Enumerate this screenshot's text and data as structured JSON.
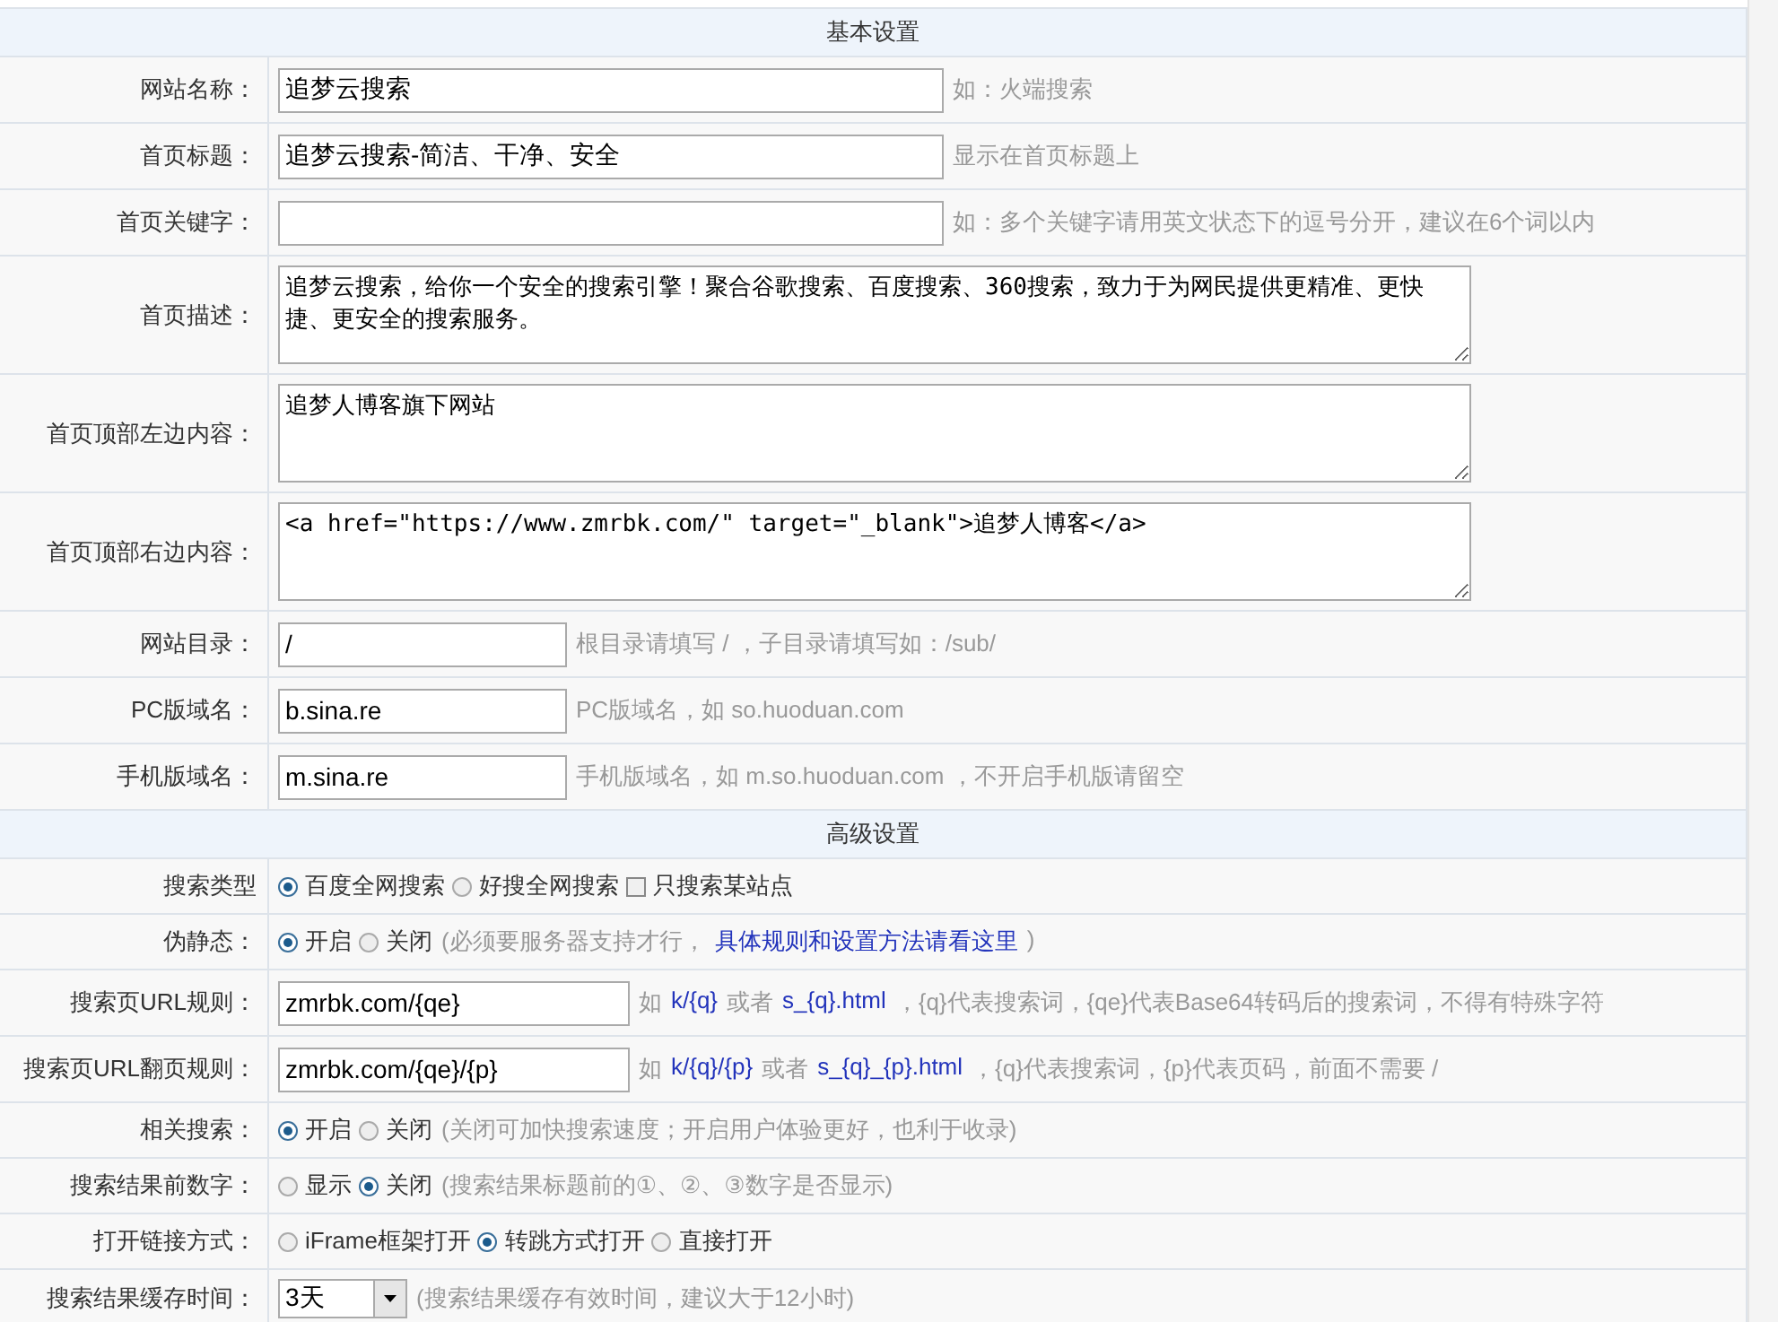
{
  "rows": [
    {
      "kind": "section",
      "title": "基本设置"
    },
    {
      "kind": "wide_input",
      "label": "网站名称：",
      "value": "追梦云搜索",
      "hint": [
        {
          "text": "如：火端搜索",
          "link": false
        }
      ]
    },
    {
      "kind": "wide_input",
      "label": "首页标题：",
      "value": "追梦云搜索-简洁、干净、安全",
      "hint": [
        {
          "text": "显示在首页标题上",
          "link": false
        }
      ]
    },
    {
      "kind": "wide_input",
      "label": "首页关键字：",
      "hint": [
        {
          "text": "如：多个关键字请用英文状态下的逗号分开，建议在6个词以内",
          "link": false
        }
      ]
    },
    {
      "kind": "textarea",
      "label": "首页描述：",
      "value": "追梦云搜索，给你一个安全的搜索引擎！聚合谷歌搜索、百度搜索、360搜索，致力于为网民提供更精准、更快捷、更安全的搜索服务。"
    },
    {
      "kind": "textarea",
      "label": "首页顶部左边内容：",
      "value": "追梦人博客旗下网站"
    },
    {
      "kind": "textarea",
      "label": "首页顶部右边内容：",
      "value": "<a href=\"https://www.zmrbk.com/\" target=\"_blank\">追梦人博客</a>"
    },
    {
      "kind": "short_input",
      "label": "网站目录：",
      "value": "/",
      "hint": [
        {
          "text": "根目录请填写 / ，子目录请填写如：/sub/",
          "link": false
        }
      ]
    },
    {
      "kind": "short_input",
      "label": "PC版域名：",
      "value": "b.sina.re",
      "hint": [
        {
          "text": "PC版域名，如 so.huoduan.com",
          "link": false
        }
      ]
    },
    {
      "kind": "short_input",
      "label": "手机版域名：",
      "value": "m.sina.re",
      "hint": [
        {
          "text": "手机版域名，如 m.so.huoduan.com ，不开启手机版请留空",
          "link": false
        }
      ]
    },
    {
      "kind": "section",
      "title": "高级设置"
    },
    {
      "kind": "options",
      "label": "搜索类型",
      "options": [
        {
          "kind": "radio",
          "label": "百度全网搜索",
          "selected": true
        },
        {
          "kind": "radio",
          "label": "好搜全网搜索",
          "selected": false
        },
        {
          "kind": "checkbox",
          "label": "只搜索某站点",
          "checked": false
        }
      ]
    },
    {
      "kind": "options",
      "label": "伪静态：",
      "options": [
        {
          "kind": "radio",
          "label": "开启",
          "selected": true
        },
        {
          "kind": "radio",
          "label": "关闭",
          "selected": false
        }
      ],
      "hint": [
        {
          "text": "(必须要服务器支持才行，",
          "link": false
        },
        {
          "text": "具体规则和设置方法请看这里",
          "link": true
        },
        {
          "text": ")",
          "link": false
        }
      ]
    },
    {
      "kind": "medium_input",
      "label": "搜索页URL规则：",
      "value": "zmrbk.com/{qe}",
      "hint": [
        {
          "text": "如",
          "link": false
        },
        {
          "text": "k/{q}",
          "link": true
        },
        {
          "text": "或者",
          "link": false
        },
        {
          "text": "s_{q}.html",
          "link": true
        },
        {
          "text": "，{q}代表搜索词，{qe}代表Base64转码后的搜索词，不得有特殊字符",
          "link": false
        }
      ]
    },
    {
      "kind": "medium_input",
      "label": "搜索页URL翻页规则：",
      "value": "zmrbk.com/{qe}/{p}",
      "hint": [
        {
          "text": "如",
          "link": false
        },
        {
          "text": "k/{q}/{p}",
          "link": true
        },
        {
          "text": "或者",
          "link": false
        },
        {
          "text": "s_{q}_{p}.html",
          "link": true
        },
        {
          "text": "，{q}代表搜索词，{p}代表页码，前面不需要 /",
          "link": false
        }
      ]
    },
    {
      "kind": "options",
      "label": "相关搜索：",
      "options": [
        {
          "kind": "radio",
          "label": "开启",
          "selected": true
        },
        {
          "kind": "radio",
          "label": "关闭",
          "selected": false
        }
      ],
      "hint": [
        {
          "text": "(关闭可加快搜索速度；开启用户体验更好，也利于收录)",
          "link": false
        }
      ]
    },
    {
      "kind": "options",
      "label": "搜索结果前数字：",
      "options": [
        {
          "kind": "radio",
          "label": "显示",
          "selected": false
        },
        {
          "kind": "radio",
          "label": "关闭",
          "selected": true
        }
      ],
      "hint": [
        {
          "text": "(搜索结果标题前的①、②、③数字是否显示)",
          "link": false
        }
      ]
    },
    {
      "kind": "options",
      "label": "打开链接方式：",
      "options": [
        {
          "kind": "radio",
          "label": "iFrame框架打开",
          "selected": false
        },
        {
          "kind": "radio",
          "label": "转跳方式打开",
          "selected": true
        },
        {
          "kind": "radio",
          "label": "直接打开",
          "selected": false
        }
      ]
    },
    {
      "kind": "select",
      "label": "搜索结果缓存时间：",
      "value": "3天",
      "hint": [
        {
          "text": "(搜索结果缓存有效时间，建议大于12小时)",
          "link": false
        }
      ]
    }
  ]
}
